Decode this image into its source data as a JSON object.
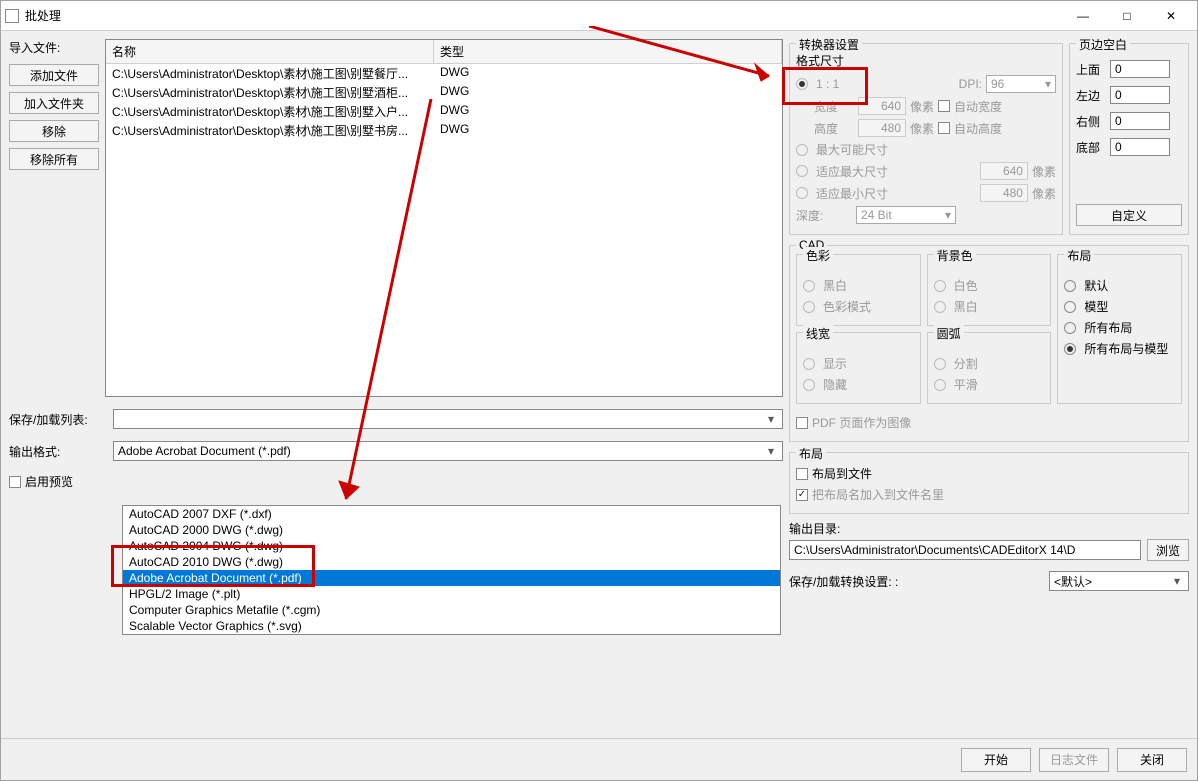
{
  "title": "批处理",
  "win_controls": {
    "min": "—",
    "max": "□",
    "close": "✕"
  },
  "import": {
    "label": "导入文件:",
    "add_file": "添加文件",
    "add_folder": "加入文件夹",
    "remove": "移除",
    "remove_all": "移除所有"
  },
  "file_table": {
    "headers": {
      "name": "名称",
      "type": "类型"
    },
    "rows": [
      {
        "name": "C:\\Users\\Administrator\\Desktop\\素材\\施工图\\别墅餐厅...",
        "type": "DWG"
      },
      {
        "name": "C:\\Users\\Administrator\\Desktop\\素材\\施工图\\别墅酒柜...",
        "type": "DWG"
      },
      {
        "name": "C:\\Users\\Administrator\\Desktop\\素材\\施工图\\别墅入户...",
        "type": "DWG"
      },
      {
        "name": "C:\\Users\\Administrator\\Desktop\\素材\\施工图\\别墅书房...",
        "type": "DWG"
      }
    ]
  },
  "save_load_list": {
    "label": "保存/加载列表:",
    "value": ""
  },
  "output_format": {
    "label": "输出格式:",
    "value": "Adobe Acrobat Document (*.pdf)",
    "options": [
      "AutoCAD 2007 DXF (*.dxf)",
      "AutoCAD 2000 DWG (*.dwg)",
      "AutoCAD 2004 DWG (*.dwg)",
      "AutoCAD 2010 DWG (*.dwg)",
      "Adobe Acrobat Document (*.pdf)",
      "HPGL/2 Image (*.plt)",
      "Computer Graphics Metafile (*.cgm)",
      "Scalable Vector Graphics (*.svg)"
    ]
  },
  "enable_preview": "启用预览",
  "converter": {
    "title": "转换器设置",
    "format_size": "格式尺寸",
    "ratio_1_1": "1 : 1",
    "dpi_label": "DPI:",
    "dpi_value": "96",
    "width_label": "宽度",
    "width_value": "640",
    "height_label": "高度",
    "height_value": "480",
    "px": "像素",
    "auto_width": "自动宽度",
    "auto_height": "自动高度",
    "max_possible": "最大可能尺寸",
    "fit_max": "适应最大尺寸",
    "fit_max_val": "640",
    "fit_min": "适应最小尺寸",
    "fit_min_val": "480",
    "depth_label": "深度:",
    "depth_value": "24 Bit"
  },
  "margin": {
    "title": "页边空白",
    "top": "上面",
    "top_v": "0",
    "left": "左边",
    "left_v": "0",
    "right": "右侧",
    "right_v": "0",
    "bottom": "底部",
    "bottom_v": "0",
    "custom": "自定义"
  },
  "cad": {
    "title": "CAD",
    "color": {
      "title": "色彩",
      "bw": "黑白",
      "colormode": "色彩模式"
    },
    "bg": {
      "title": "背景色",
      "white": "白色",
      "black": "黑白"
    },
    "layout": {
      "title": "布局",
      "default": "默认",
      "model": "模型",
      "all_layouts": "所有布局",
      "all_layouts_model": "所有布局与模型"
    },
    "linewidth": {
      "title": "线宽",
      "show": "显示",
      "hide": "隐藏"
    },
    "arc": {
      "title": "圆弧",
      "split": "分割",
      "smooth": "平滑"
    },
    "pdf_as_image": "PDF 页面作为图像"
  },
  "layout_group": {
    "title": "布局",
    "to_file": "布局到文件",
    "add_name": "把布局名加入到文件名里"
  },
  "output": {
    "label": "输出目录:",
    "value": "C:\\Users\\Administrator\\Documents\\CADEditorX 14\\D",
    "browse": "浏览"
  },
  "save_load_conv": {
    "label": "保存/加载转换设置: :",
    "value": "<默认>"
  },
  "footer": {
    "start": "开始",
    "log": "日志文件",
    "close": "关闭"
  }
}
